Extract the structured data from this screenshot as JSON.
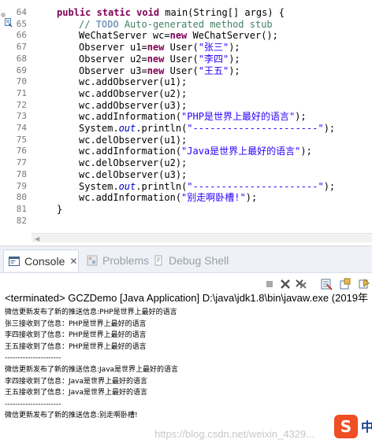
{
  "editor": {
    "line_numbers": [
      "64",
      "65",
      "66",
      "67",
      "68",
      "69",
      "70",
      "71",
      "72",
      "73",
      "74",
      "75",
      "76",
      "77",
      "78",
      "79",
      "80",
      "81",
      "82"
    ],
    "lines": [
      {
        "parts": [
          {
            "t": "public static void ",
            "c": "kw"
          },
          {
            "t": "main(String[] args) {",
            "c": ""
          }
        ]
      },
      {
        "parts": [
          {
            "t": "// ",
            "c": "cm"
          },
          {
            "t": "TODO",
            "c": "cm-tag"
          },
          {
            "t": " Auto-generated method stub",
            "c": "cm"
          }
        ]
      },
      {
        "parts": [
          {
            "t": "WeChatServer wc=",
            "c": ""
          },
          {
            "t": "new ",
            "c": "kw"
          },
          {
            "t": "WeChatServer();",
            "c": ""
          }
        ]
      },
      {
        "parts": [
          {
            "t": "Observer u1=",
            "c": ""
          },
          {
            "t": "new ",
            "c": "kw"
          },
          {
            "t": "User(",
            "c": ""
          },
          {
            "t": "\"张三\"",
            "c": "str"
          },
          {
            "t": ");",
            "c": ""
          }
        ]
      },
      {
        "parts": [
          {
            "t": "Observer u2=",
            "c": ""
          },
          {
            "t": "new ",
            "c": "kw"
          },
          {
            "t": "User(",
            "c": ""
          },
          {
            "t": "\"李四\"",
            "c": "str"
          },
          {
            "t": ");",
            "c": ""
          }
        ]
      },
      {
        "parts": [
          {
            "t": "Observer u3=",
            "c": ""
          },
          {
            "t": "new ",
            "c": "kw"
          },
          {
            "t": "User(",
            "c": ""
          },
          {
            "t": "\"王五\"",
            "c": "str"
          },
          {
            "t": ");",
            "c": ""
          }
        ]
      },
      {
        "parts": [
          {
            "t": "wc.addObserver(u1);",
            "c": ""
          }
        ]
      },
      {
        "parts": [
          {
            "t": "wc.addObserver(u2);",
            "c": ""
          }
        ]
      },
      {
        "parts": [
          {
            "t": "wc.addObserver(u3);",
            "c": ""
          }
        ]
      },
      {
        "parts": [
          {
            "t": "wc.addInformation(",
            "c": ""
          },
          {
            "t": "\"PHP是世界上最好的语言\"",
            "c": "str"
          },
          {
            "t": ");",
            "c": ""
          }
        ]
      },
      {
        "parts": [
          {
            "t": "System.",
            "c": ""
          },
          {
            "t": "out",
            "c": "fld"
          },
          {
            "t": ".println(",
            "c": ""
          },
          {
            "t": "\"----------------------\"",
            "c": "str"
          },
          {
            "t": ");",
            "c": ""
          }
        ]
      },
      {
        "parts": [
          {
            "t": "wc.delObserver(u1);",
            "c": ""
          }
        ]
      },
      {
        "parts": [
          {
            "t": "wc.addInformation(",
            "c": ""
          },
          {
            "t": "\"Java是世界上最好的语言\"",
            "c": "str"
          },
          {
            "t": ");",
            "c": ""
          }
        ]
      },
      {
        "parts": [
          {
            "t": "wc.delObserver(u2);",
            "c": ""
          }
        ]
      },
      {
        "parts": [
          {
            "t": "wc.delObserver(u3);",
            "c": ""
          }
        ]
      },
      {
        "parts": [
          {
            "t": "System.",
            "c": ""
          },
          {
            "t": "out",
            "c": "fld"
          },
          {
            "t": ".println(",
            "c": ""
          },
          {
            "t": "\"----------------------\"",
            "c": "str"
          },
          {
            "t": ");",
            "c": ""
          }
        ]
      },
      {
        "parts": [
          {
            "t": "wc.addInformation(",
            "c": ""
          },
          {
            "t": "\"别走啊卧槽!\"",
            "c": "str"
          },
          {
            "t": ");",
            "c": ""
          }
        ]
      },
      {
        "parts": [
          {
            "t": "}",
            "c": ""
          }
        ]
      },
      {
        "parts": []
      }
    ]
  },
  "tabs": {
    "console": "Console",
    "problems": "Problems",
    "debug_shell": "Debug Shell"
  },
  "console": {
    "status": "<terminated> GCZDemo [Java Application] D:\\java\\jdk1.8\\bin\\javaw.exe (2019年",
    "output": [
      "微信更新发布了新的推送信息:PHP是世界上最好的语言",
      "张三接收到了信息：PHP是世界上最好的语言",
      "李四接收到了信息：PHP是世界上最好的语言",
      "王五接收到了信息：PHP是世界上最好的语言",
      "----------------------",
      "微信更新发布了新的推送信息:Java是世界上最好的语言",
      "李四接收到了信息：Java是世界上最好的语言",
      "王五接收到了信息：Java是世界上最好的语言",
      "----------------------",
      "微信更新发布了新的推送信息:别走啊卧槽!"
    ]
  },
  "watermark": "https://blog.csdn.net/weixin_4329...",
  "sogou_label": "S",
  "sogou_zh": "中"
}
